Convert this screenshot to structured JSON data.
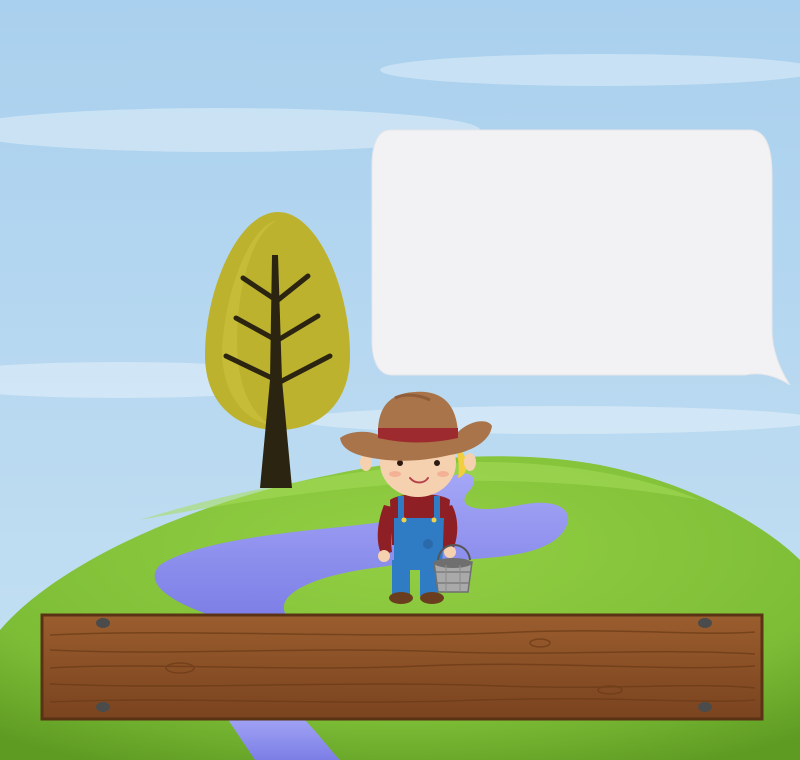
{
  "scene": {
    "speech_bubble": {
      "text": ""
    },
    "sign": {
      "text": ""
    }
  },
  "colors": {
    "sky_top": "#a9d0ee",
    "sky_bottom": "#c9e2f3",
    "hill": "#82c23b",
    "hill_dark": "#5f9e22",
    "river": "#9496f2",
    "tree_canopy": "#bdb22e",
    "tree_trunk": "#2b2410",
    "bubble": "#f2f2f4",
    "wood": "#8b5127",
    "wood_dark": "#6a3a17",
    "hat": "#a9744a",
    "hat_band": "#9c2a2e",
    "hair": "#f1cf3f",
    "skin": "#f6d1b0",
    "shirt": "#8e1f24",
    "overalls": "#2f7bc4",
    "bucket": "#a9a9a9"
  },
  "icons": [
    "tree-icon",
    "farmer-boy-icon",
    "bucket-icon",
    "nail-icon"
  ]
}
